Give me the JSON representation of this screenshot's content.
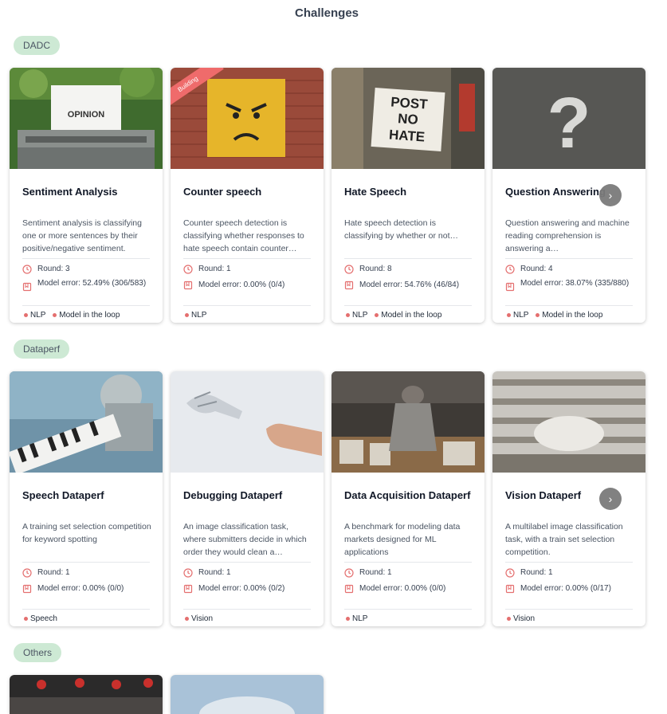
{
  "page": {
    "title": "Challenges"
  },
  "colors": {
    "tag_bg": "#cde9d4",
    "accent": "#e46f6f",
    "nav": "#7b7b7b"
  },
  "sections": [
    {
      "label": "DADC",
      "cards": [
        {
          "title": "Sentiment Analysis",
          "description": "Sentiment analysis is classifying one or more sentences by their positive/negative sentiment.",
          "round": "Round: 3",
          "model_error": "Model error: 52.49% (306/583)",
          "tags": [
            "NLP",
            "Model in the loop"
          ],
          "image_text": "OPINION"
        },
        {
          "title": "Counter speech",
          "badge": "Building",
          "description": "Counter speech detection is classifying whether responses to hate speech contain counter…",
          "round": "Round: 1",
          "model_error": "Model error: 0.00% (0/4)",
          "tags": [
            "NLP"
          ]
        },
        {
          "title": "Hate Speech",
          "description": "Hate speech detection is classifying by whether or not…",
          "round": "Round: 8",
          "model_error": "Model error: 54.76% (46/84)",
          "tags": [
            "NLP",
            "Model in the loop"
          ],
          "image_text": [
            "POST",
            "NO",
            "HATE"
          ]
        },
        {
          "title": "Question Answering",
          "description": "Question answering and machine reading comprehension is answering a…",
          "round": "Round: 4",
          "model_error": "Model error: 38.07% (335/880)",
          "tags": [
            "NLP",
            "Model in the loop"
          ],
          "image_text": "?"
        }
      ]
    },
    {
      "label": "Dataperf",
      "cards": [
        {
          "title": "Speech Dataperf",
          "description": "A training set selection competition for keyword spotting",
          "round": "Round: 1",
          "model_error": "Model error: 0.00% (0/0)",
          "tags": [
            "Speech"
          ]
        },
        {
          "title": "Debugging Dataperf",
          "description": "An image classification task, where submitters decide in which order they would clean a…",
          "round": "Round: 1",
          "model_error": "Model error: 0.00% (0/2)",
          "tags": [
            "Vision"
          ]
        },
        {
          "title": "Data Acquisition Dataperf",
          "description": "A benchmark for modeling data markets designed for ML applications",
          "round": "Round: 1",
          "model_error": "Model error: 0.00% (0/0)",
          "tags": [
            "NLP"
          ]
        },
        {
          "title": "Vision Dataperf",
          "description": "A multilabel image classification task, with a train set selection competition.",
          "round": "Round: 1",
          "model_error": "Model error: 0.00% (0/17)",
          "tags": [
            "Vision"
          ]
        }
      ]
    },
    {
      "label": "Others"
    }
  ],
  "nav": {
    "next_symbol": "›"
  }
}
